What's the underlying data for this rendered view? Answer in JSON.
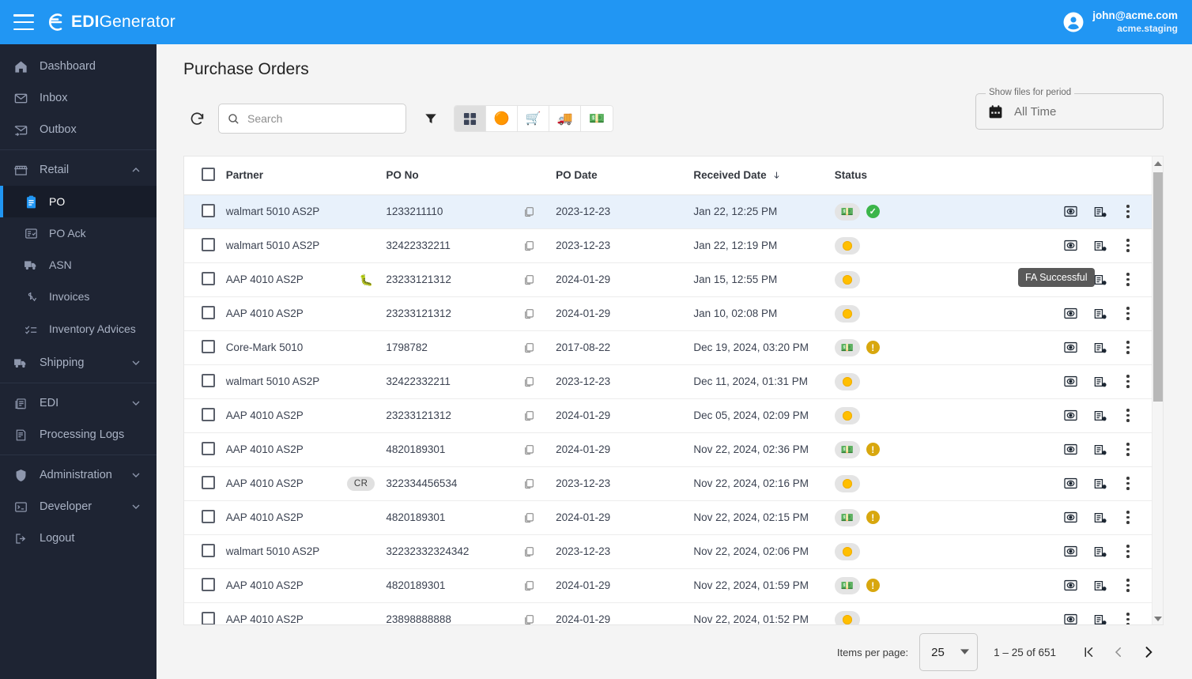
{
  "topbar": {
    "menu_icon": "hamburger-icon",
    "brand_bold": "EDI",
    "brand_light": "Generator",
    "user_email": "john@acme.com",
    "user_tenant": "acme.staging",
    "accent_color": "#2196f3"
  },
  "sidebar": {
    "items": [
      {
        "label": "Dashboard",
        "icon": "home-icon",
        "type": "item"
      },
      {
        "label": "Inbox",
        "icon": "inbox-icon",
        "type": "item"
      },
      {
        "label": "Outbox",
        "icon": "outbox-icon",
        "type": "item"
      },
      {
        "label": "Retail",
        "icon": "store-icon",
        "type": "group",
        "expanded": true,
        "chevron": "chevron-up-icon"
      },
      {
        "label": "PO",
        "icon": "clipboard-icon",
        "type": "sub",
        "active": true
      },
      {
        "label": "PO Ack",
        "icon": "list-check-icon",
        "type": "sub"
      },
      {
        "label": "ASN",
        "icon": "truck-icon",
        "type": "sub"
      },
      {
        "label": "Invoices",
        "icon": "invoice-icon",
        "type": "sub"
      },
      {
        "label": "Inventory Advices",
        "icon": "inventory-icon",
        "type": "sub"
      },
      {
        "label": "Shipping",
        "icon": "truck-icon",
        "type": "group",
        "expanded": false,
        "chevron": "chevron-down-icon"
      },
      {
        "label": "EDI",
        "icon": "edi-icon",
        "type": "group",
        "expanded": false,
        "chevron": "chevron-down-icon"
      },
      {
        "label": "Processing Logs",
        "icon": "logs-icon",
        "type": "item"
      },
      {
        "label": "Administration",
        "icon": "shield-icon",
        "type": "group",
        "expanded": false,
        "chevron": "chevron-down-icon"
      },
      {
        "label": "Developer",
        "icon": "terminal-icon",
        "type": "group",
        "expanded": false,
        "chevron": "chevron-down-icon"
      },
      {
        "label": "Logout",
        "icon": "logout-icon",
        "type": "item"
      }
    ]
  },
  "page": {
    "title": "Purchase Orders"
  },
  "toolbar": {
    "refresh_icon": "refresh-icon",
    "search_placeholder": "Search",
    "search_value": "",
    "search_icon": "search-icon",
    "filter_icon": "filter-icon",
    "view_toggles": [
      {
        "name": "grid-view",
        "icon": "grid-icon",
        "glyph": "",
        "selected": true
      },
      {
        "name": "status-view",
        "icon": "sun-icon",
        "glyph": "🟠",
        "selected": false
      },
      {
        "name": "cart-view",
        "icon": "cart-icon",
        "glyph": "🛒",
        "selected": false
      },
      {
        "name": "shipping-view",
        "icon": "truck-icon",
        "glyph": "🚚",
        "selected": false
      },
      {
        "name": "invoice-view",
        "icon": "money-icon",
        "glyph": "💵",
        "selected": false
      }
    ]
  },
  "period_filter": {
    "legend": "Show files for period",
    "value": "All Time",
    "icon": "calendar-icon"
  },
  "table": {
    "headers": {
      "select_all": "",
      "partner": "Partner",
      "po_no": "PO No",
      "po_date": "PO Date",
      "received_date": "Received Date",
      "sort_icon": "arrow-down-icon",
      "status": "Status"
    },
    "rows": [
      {
        "partner": "walmart 5010 AS2P",
        "tag": "",
        "po_no": "1233211110",
        "po_date": "2023-12-23",
        "received_date": "Jan 22, 12:25 PM",
        "status_pill": "money",
        "status_badge": "ok",
        "selected": true
      },
      {
        "partner": "walmart 5010 AS2P",
        "tag": "",
        "po_no": "32422332211",
        "po_date": "2023-12-23",
        "received_date": "Jan 22, 12:19 PM",
        "status_pill": "orange",
        "status_badge": "",
        "selected": false
      },
      {
        "partner": "AAP 4010 AS2P",
        "tag": "bug",
        "po_no": "23233121312",
        "po_date": "2024-01-29",
        "received_date": "Jan 15, 12:55 PM",
        "status_pill": "orange",
        "status_badge": "",
        "selected": false
      },
      {
        "partner": "AAP 4010 AS2P",
        "tag": "",
        "po_no": "23233121312",
        "po_date": "2024-01-29",
        "received_date": "Jan 10, 02:08 PM",
        "status_pill": "orange",
        "status_badge": "",
        "selected": false
      },
      {
        "partner": "Core-Mark 5010",
        "tag": "",
        "po_no": "1798782",
        "po_date": "2017-08-22",
        "received_date": "Dec 19, 2024, 03:20 PM",
        "status_pill": "money",
        "status_badge": "warn",
        "selected": false
      },
      {
        "partner": "walmart 5010 AS2P",
        "tag": "",
        "po_no": "32422332211",
        "po_date": "2023-12-23",
        "received_date": "Dec 11, 2024, 01:31 PM",
        "status_pill": "orange",
        "status_badge": "",
        "selected": false
      },
      {
        "partner": "AAP 4010 AS2P",
        "tag": "",
        "po_no": "23233121312",
        "po_date": "2024-01-29",
        "received_date": "Dec 05, 2024, 02:09 PM",
        "status_pill": "orange",
        "status_badge": "",
        "selected": false
      },
      {
        "partner": "AAP 4010 AS2P",
        "tag": "",
        "po_no": "4820189301",
        "po_date": "2024-01-29",
        "received_date": "Nov 22, 2024, 02:36 PM",
        "status_pill": "money",
        "status_badge": "warn",
        "selected": false
      },
      {
        "partner": "AAP 4010 AS2P",
        "tag": "CR",
        "po_no": "322334456534",
        "po_date": "2023-12-23",
        "received_date": "Nov 22, 2024, 02:16 PM",
        "status_pill": "orange",
        "status_badge": "",
        "selected": false
      },
      {
        "partner": "AAP 4010 AS2P",
        "tag": "",
        "po_no": "4820189301",
        "po_date": "2024-01-29",
        "received_date": "Nov 22, 2024, 02:15 PM",
        "status_pill": "money",
        "status_badge": "warn",
        "selected": false
      },
      {
        "partner": "walmart 5010 AS2P",
        "tag": "",
        "po_no": "32232332324342",
        "po_date": "2023-12-23",
        "received_date": "Nov 22, 2024, 02:06 PM",
        "status_pill": "orange",
        "status_badge": "",
        "selected": false
      },
      {
        "partner": "AAP 4010 AS2P",
        "tag": "",
        "po_no": "4820189301",
        "po_date": "2024-01-29",
        "received_date": "Nov 22, 2024, 01:59 PM",
        "status_pill": "money",
        "status_badge": "warn",
        "selected": false
      },
      {
        "partner": "AAP 4010 AS2P",
        "tag": "",
        "po_no": "23898888888",
        "po_date": "2024-01-29",
        "received_date": "Nov 22, 2024, 01:52 PM",
        "status_pill": "orange",
        "status_badge": "",
        "selected": false
      }
    ],
    "row_actions": [
      {
        "name": "preview-icon"
      },
      {
        "name": "document-settings-icon"
      },
      {
        "name": "more-menu-icon"
      }
    ]
  },
  "tooltip": {
    "text": "FA Successful"
  },
  "paginator": {
    "items_per_page_label": "Items per page:",
    "items_per_page_value": "25",
    "range_label": "1 – 25 of 651",
    "first_icon": "first-page-icon",
    "prev_icon": "previous-page-icon",
    "next_icon": "next-page-icon"
  }
}
